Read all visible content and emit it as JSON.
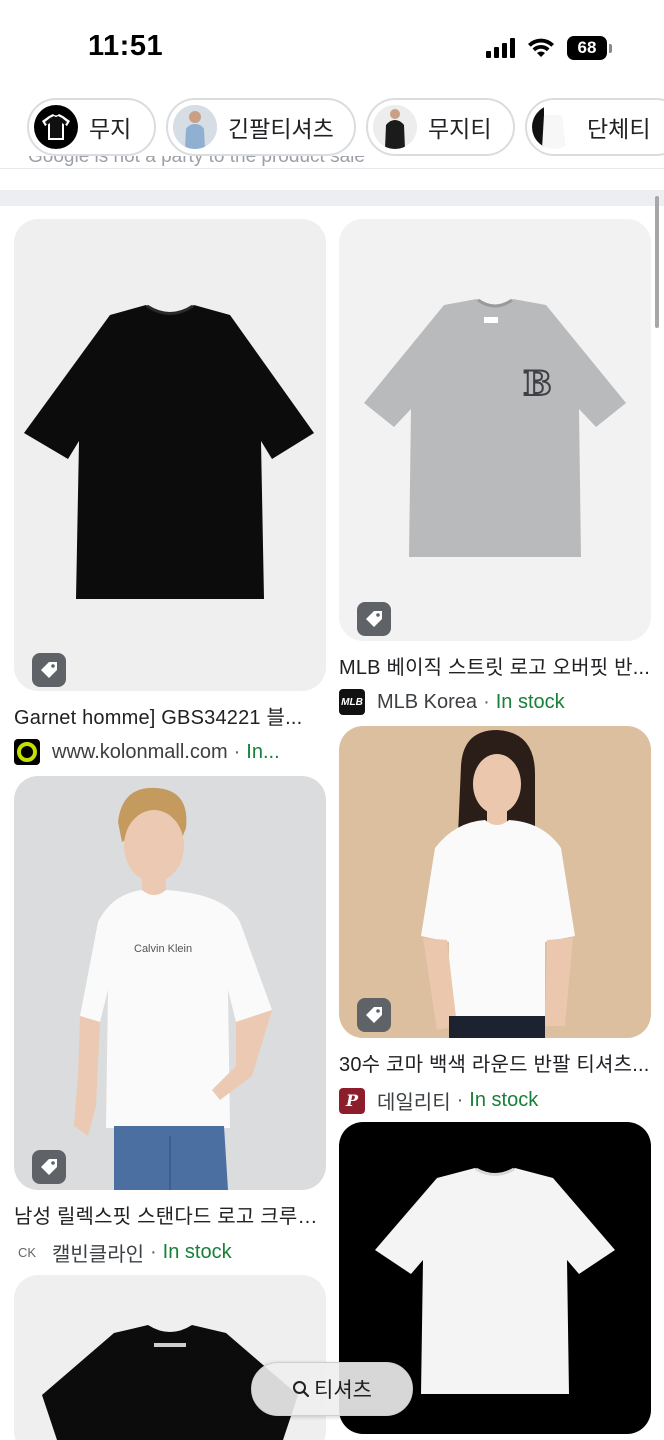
{
  "status_bar": {
    "time": "11:51",
    "battery": "68"
  },
  "chips": [
    {
      "label": "무지",
      "icon": "black-tshirt-thumbnail"
    },
    {
      "label": "긴팔티셔츠",
      "icon": "person-tshirt-thumbnail"
    },
    {
      "label": "무지티",
      "icon": "black-polo-thumbnail"
    },
    {
      "label": "단체티",
      "icon": "white-tshirt-thumbnail"
    }
  ],
  "cut_off_text": "Google is not a party to the product sale",
  "products": [
    {
      "title": "Garnet homme] GBS34221 블...",
      "merchant": "www.kolonmall.com",
      "separator": "·",
      "stock": "In...",
      "logo_icon": "kolon-ring-logo"
    },
    {
      "title": "MLB 베이직 스트릿 로고 오버핏 반...",
      "merchant": "MLB Korea",
      "separator": "·",
      "stock": "In stock",
      "logo_icon": "mlb-logo",
      "logo_text": "MLB"
    },
    {
      "title": "30수 코마 백색 라운드 반팔 티셔츠...",
      "merchant": "데일리티",
      "separator": "·",
      "stock": "In stock",
      "logo_icon": "dailytee-logo",
      "logo_text": "P"
    },
    {
      "title": "남성 릴렉스핏 스탠다드 로고 크루넥...",
      "merchant": "캘빈클라인",
      "separator": "·",
      "stock": "In stock",
      "logo_icon": "ck-logo",
      "logo_text": "CK"
    },
    {
      "title": "",
      "merchant": "",
      "stock": ""
    },
    {
      "title": "",
      "merchant": "",
      "stock": ""
    }
  ],
  "product_image_text": {
    "calvin_klein_print": "Calvin Klein"
  },
  "search_pill": {
    "label": "티셔츠",
    "icon": "search-icon"
  },
  "colors": {
    "stock_green": "#188038",
    "chip_border": "#dadce0",
    "tag_gray": "#5f6368"
  }
}
